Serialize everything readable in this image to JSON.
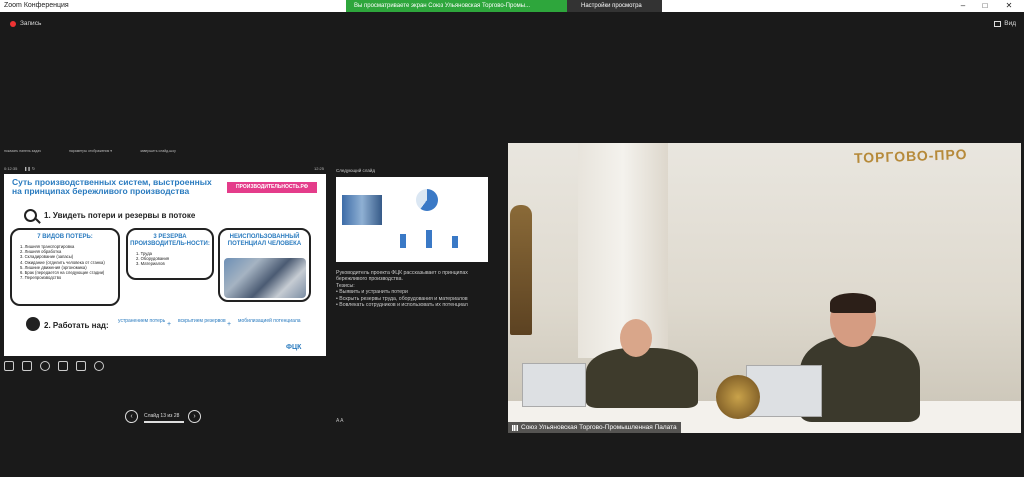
{
  "window": {
    "title": "Zoom Конференция",
    "share_banner": "Вы просматриваете экран Союз Ульяновская Торгово-Промы...",
    "view_settings": "Настройки просмотра",
    "minimize": "–",
    "maximize": "□",
    "close": "✕"
  },
  "topbar": {
    "record_label": "Запись",
    "view_label": "Вид"
  },
  "presenter": {
    "toolbar": [
      "показать панель задач",
      "параметры отображения ▾",
      "завершить слайд-шоу"
    ],
    "time_left": "0:12:35",
    "time_right": "12:25",
    "slide": {
      "title": "Суть производственных систем, выстроенных на принципах бережливого производства",
      "badge": "ПРОИЗВОДИТЕЛЬНОСТЬ.РФ",
      "step1": "1. Увидеть потери и резервы в потоке",
      "box1_title": "7 ВИДОВ ПОТЕРЬ:",
      "box1_items": [
        "1. Лишняя транспортировка",
        "2. Лишняя обработка",
        "3. Складирование (запасы)",
        "4. Ожидание (отделить человека от станка)",
        "5. Лишние движения (эргономика)",
        "6. Брак (передается на следующие стадии)",
        "7. Перепроизводство"
      ],
      "box2_title": "3 РЕЗЕРВА ПРОИЗВОДИТЕЛЬ-НОСТИ:",
      "box2_items": [
        "1. Труда",
        "2. Оборудования",
        "3. Материалов"
      ],
      "box3_title": "НЕИСПОЛЬЗОВАННЫЙ ПОТЕНЦИАЛ ЧЕЛОВЕКА",
      "step2": "2. Работать над:",
      "work": [
        "устранением потерь",
        "вскрытием резервов",
        "мобилизацией потенциала"
      ],
      "plus": "+",
      "logo": "ФЦК"
    },
    "slide_counter": "Слайд 13 из 28",
    "prev": "‹",
    "next": "›"
  },
  "notes": {
    "next_slide_label": "Следующий слайд",
    "intro": "Руководитель проекта ФЦК рассказывает о принципах бережливого производства.",
    "theses_label": "Тезисы:",
    "items": [
      "Выявить и устранить потери",
      "Вскрыть резервы труда, оборудования и материалов",
      "Вовлекать сотрудников и использовать их потенциал"
    ],
    "tools": "A  A"
  },
  "video": {
    "wall_text": "ТОРГОВО-ПРО",
    "participant_name": "Союз Ульяновская Торгово-Промышленная Палата"
  },
  "colors": {
    "share_banner": "#2ea63c",
    "slide_accent": "#2a7bbf",
    "badge": "#e43c8a",
    "record": "#e33"
  }
}
